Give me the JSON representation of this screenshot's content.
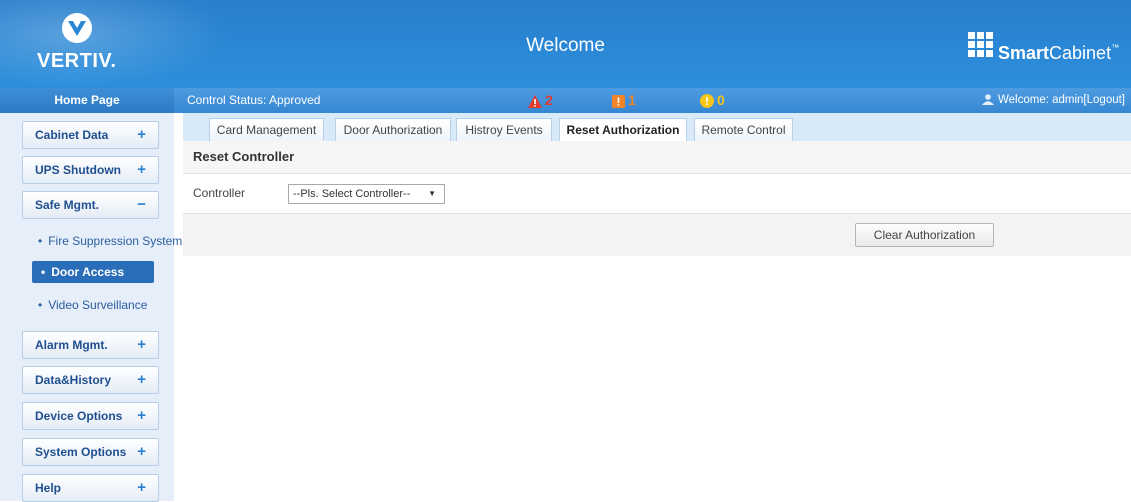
{
  "header": {
    "logo_text": "VERTIV.",
    "title": "Welcome",
    "brand_bold": "Smart",
    "brand_rest": "Cabinet",
    "brand_tm": "™"
  },
  "status_bar": {
    "home_label": "Home Page",
    "control_status": "Control Status:  Approved",
    "alarms": {
      "critical": "2",
      "major": "1",
      "minor": "0"
    },
    "user_welcome": "Welcome: admin[Logout]"
  },
  "sidebar": {
    "menus": [
      {
        "label": "Cabinet Data",
        "sign": "+"
      },
      {
        "label": "UPS Shutdown",
        "sign": "+"
      },
      {
        "label": "Safe Mgmt.",
        "sign": "−"
      },
      {
        "label": "Alarm Mgmt.",
        "sign": "+"
      },
      {
        "label": "Data&History",
        "sign": "+"
      },
      {
        "label": "Device Options",
        "sign": "+"
      },
      {
        "label": "System Options",
        "sign": "+"
      },
      {
        "label": "Help",
        "sign": "+"
      }
    ],
    "sub_items": [
      {
        "label": "Fire Suppression System"
      },
      {
        "label": "Door Access"
      },
      {
        "label": "Video Surveillance"
      }
    ]
  },
  "tabs": [
    {
      "label": "Card Management"
    },
    {
      "label": "Door Authorization"
    },
    {
      "label": "Histroy Events"
    },
    {
      "label": "Reset Authorization"
    },
    {
      "label": "Remote Control"
    }
  ],
  "panel": {
    "title": "Reset Controller",
    "controller_label": "Controller",
    "controller_selected": "--Pls. Select Controller--",
    "clear_button": "Clear Authorization"
  },
  "colors": {
    "header_blue": "#2a86d4",
    "sidebar_bg": "#e6eff9",
    "menu_text": "#1f4f8f",
    "active_sub": "#2a6db9",
    "alarm_critical": "#e23b2b",
    "alarm_major": "#f0822a",
    "alarm_minor": "#f5c518"
  }
}
